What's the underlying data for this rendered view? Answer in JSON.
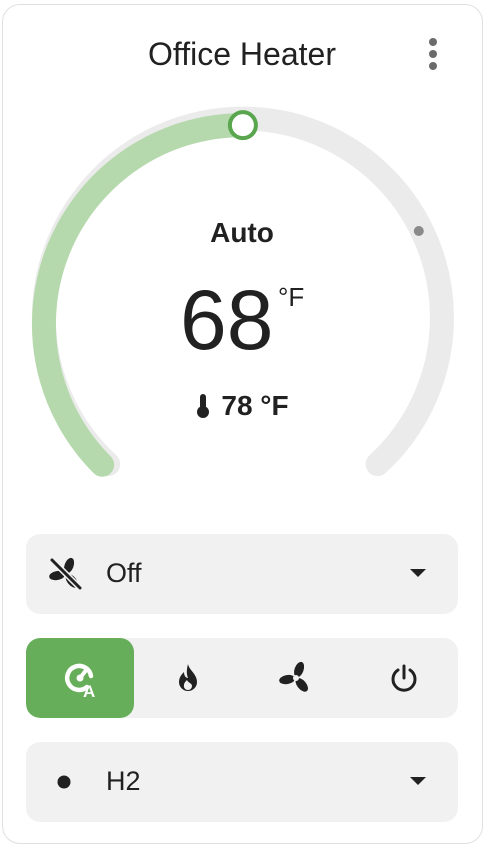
{
  "card": {
    "title": "Office Heater",
    "menu_icon": "dots-vertical-icon"
  },
  "thermostat": {
    "mode_label": "Auto",
    "target_temperature": "68",
    "target_unit": "°F",
    "current_temperature": "78 °F",
    "current_icon": "thermometer-icon",
    "min_temp": 45,
    "max_temp": 95,
    "setpoint_fraction": 0.5,
    "current_fraction": 0.73
  },
  "fan_mode": {
    "icon": "fan-off-icon",
    "value": "Off"
  },
  "hvac_modes": [
    {
      "name": "auto",
      "icon": "thermostat-auto-icon",
      "active": true
    },
    {
      "name": "heat",
      "icon": "fire-icon",
      "active": false
    },
    {
      "name": "fan_only",
      "icon": "fan-icon",
      "active": false
    },
    {
      "name": "off",
      "icon": "power-icon",
      "active": false
    }
  ],
  "preset": {
    "icon": "circle-small-icon",
    "value": "H2"
  },
  "colors": {
    "accent_green": "#66ae5a",
    "arc_green": "#b5d9ad",
    "arc_gray": "#ebebeb",
    "surface": "#f1f1f1"
  }
}
